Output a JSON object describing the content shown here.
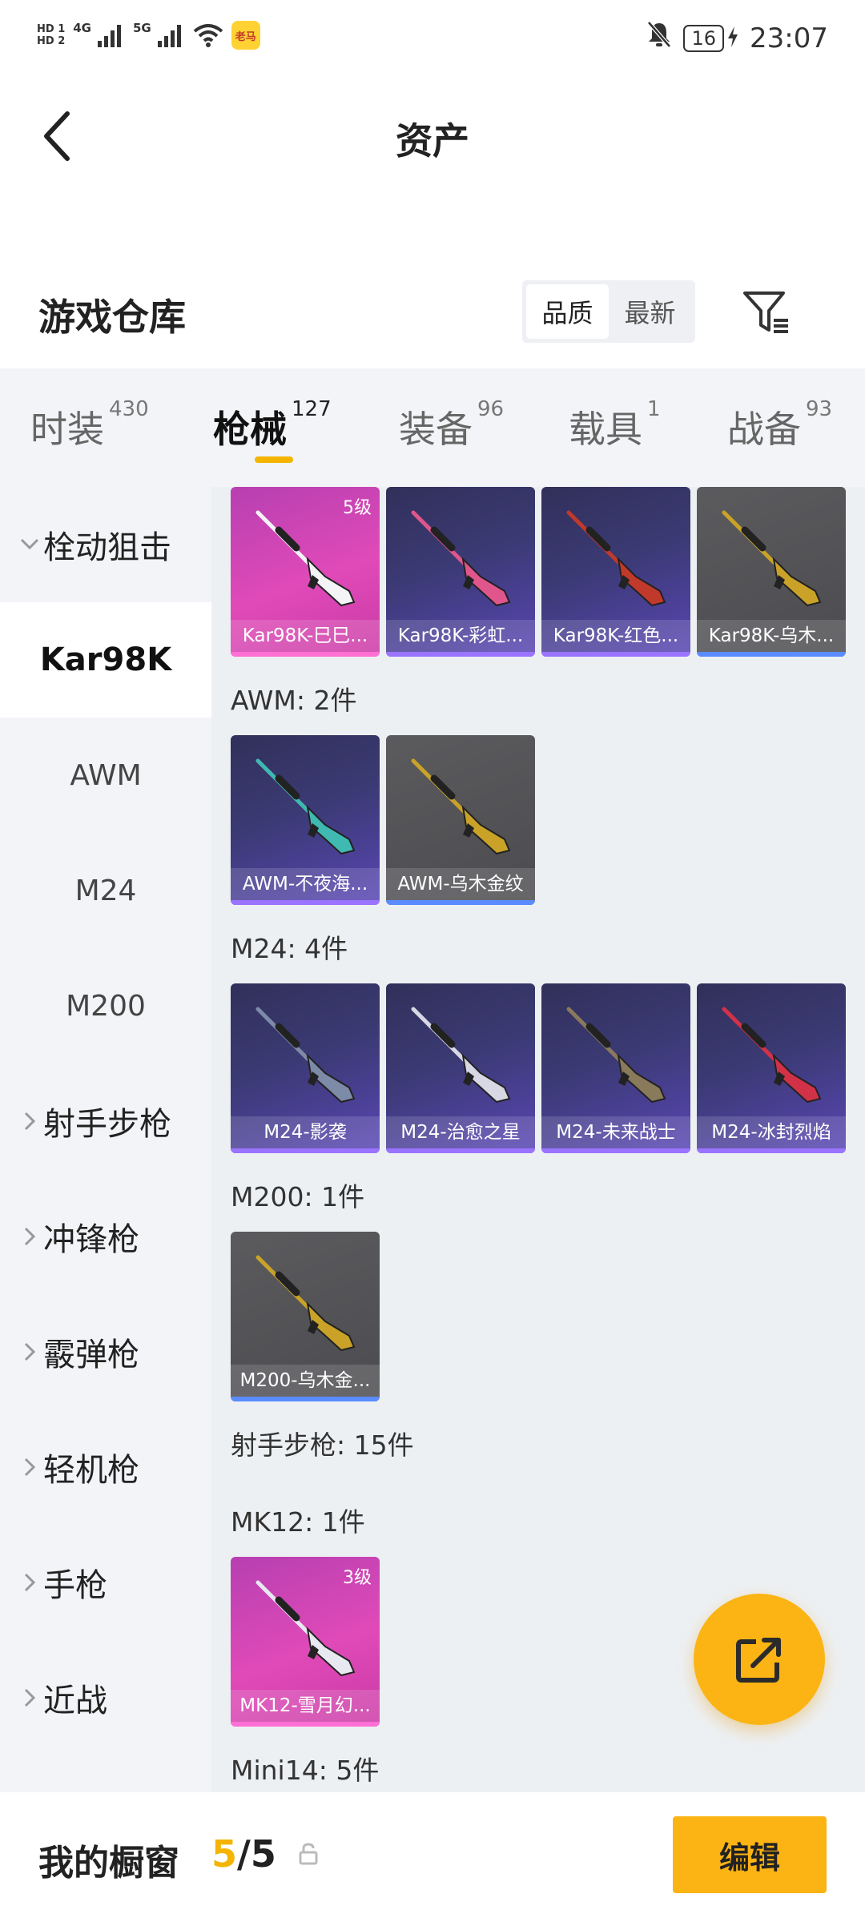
{
  "status_bar": {
    "hd1": "HD 1",
    "hd2": "HD 2",
    "net1": "4G",
    "net2": "5G",
    "app_badge": "老马",
    "battery": "16",
    "time": "23:07"
  },
  "header": {
    "title": "资产"
  },
  "warehouse": {
    "title": "游戏仓库",
    "sort_options": [
      "品质",
      "最新"
    ]
  },
  "tabs": [
    {
      "label": "时装",
      "count": "430"
    },
    {
      "label": "枪械",
      "count": "127"
    },
    {
      "label": "装备",
      "count": "96"
    },
    {
      "label": "载具",
      "count": "1"
    },
    {
      "label": "战备",
      "count": "93"
    }
  ],
  "sidebar": {
    "items": [
      {
        "label": "栓动狙击",
        "type": "category",
        "expanded": true
      },
      {
        "label": "Kar98K",
        "type": "sub",
        "active": true
      },
      {
        "label": "AWM",
        "type": "sub"
      },
      {
        "label": "M24",
        "type": "sub"
      },
      {
        "label": "M200",
        "type": "sub"
      },
      {
        "label": "射手步枪",
        "type": "category"
      },
      {
        "label": "冲锋枪",
        "type": "category"
      },
      {
        "label": "霰弹枪",
        "type": "category"
      },
      {
        "label": "轻机枪",
        "type": "category"
      },
      {
        "label": "手枪",
        "type": "category"
      },
      {
        "label": "近战",
        "type": "category"
      }
    ]
  },
  "main": {
    "kar98k_items": [
      {
        "name": "Kar98K-巳巳...",
        "rarity": "gold",
        "level": "5级",
        "gun_color": "#f4f4f6"
      },
      {
        "name": "Kar98K-彩虹...",
        "rarity": "purple",
        "gun_color": "#e0568c"
      },
      {
        "name": "Kar98K-红色...",
        "rarity": "purple",
        "gun_color": "#c0392b"
      },
      {
        "name": "Kar98K-乌木...",
        "rarity": "gray",
        "gun_color": "#c9a227"
      }
    ],
    "awm_label": "AWM: 2件",
    "awm_items": [
      {
        "name": "AWM-不夜海...",
        "rarity": "purple",
        "gun_color": "#3fb9b1"
      },
      {
        "name": "AWM-乌木金纹",
        "rarity": "gray",
        "gun_color": "#c9a227"
      }
    ],
    "m24_label": "M24: 4件",
    "m24_items": [
      {
        "name": "M24-影袭",
        "rarity": "purple",
        "gun_color": "#7d8aa8"
      },
      {
        "name": "M24-治愈之星",
        "rarity": "purple",
        "gun_color": "#d8d8e4"
      },
      {
        "name": "M24-未来战士",
        "rarity": "purple",
        "gun_color": "#8a7a5c"
      },
      {
        "name": "M24-冰封烈焰",
        "rarity": "purple",
        "gun_color": "#d23248"
      }
    ],
    "m200_label": "M200: 1件",
    "m200_items": [
      {
        "name": "M200-乌木金...",
        "rarity": "gray",
        "gun_color": "#c9a227"
      }
    ],
    "marksman_label": "射手步枪: 15件",
    "mk12_label": "MK12: 1件",
    "mk12_items": [
      {
        "name": "MK12-雪月幻...",
        "rarity": "gold",
        "level": "3级",
        "gun_color": "#e8e8f0"
      }
    ],
    "mini14_label": "Mini14: 5件"
  },
  "bottom_bar": {
    "title": "我的橱窗",
    "current": "5",
    "separator": "/",
    "total": "5",
    "edit_label": "编辑"
  }
}
